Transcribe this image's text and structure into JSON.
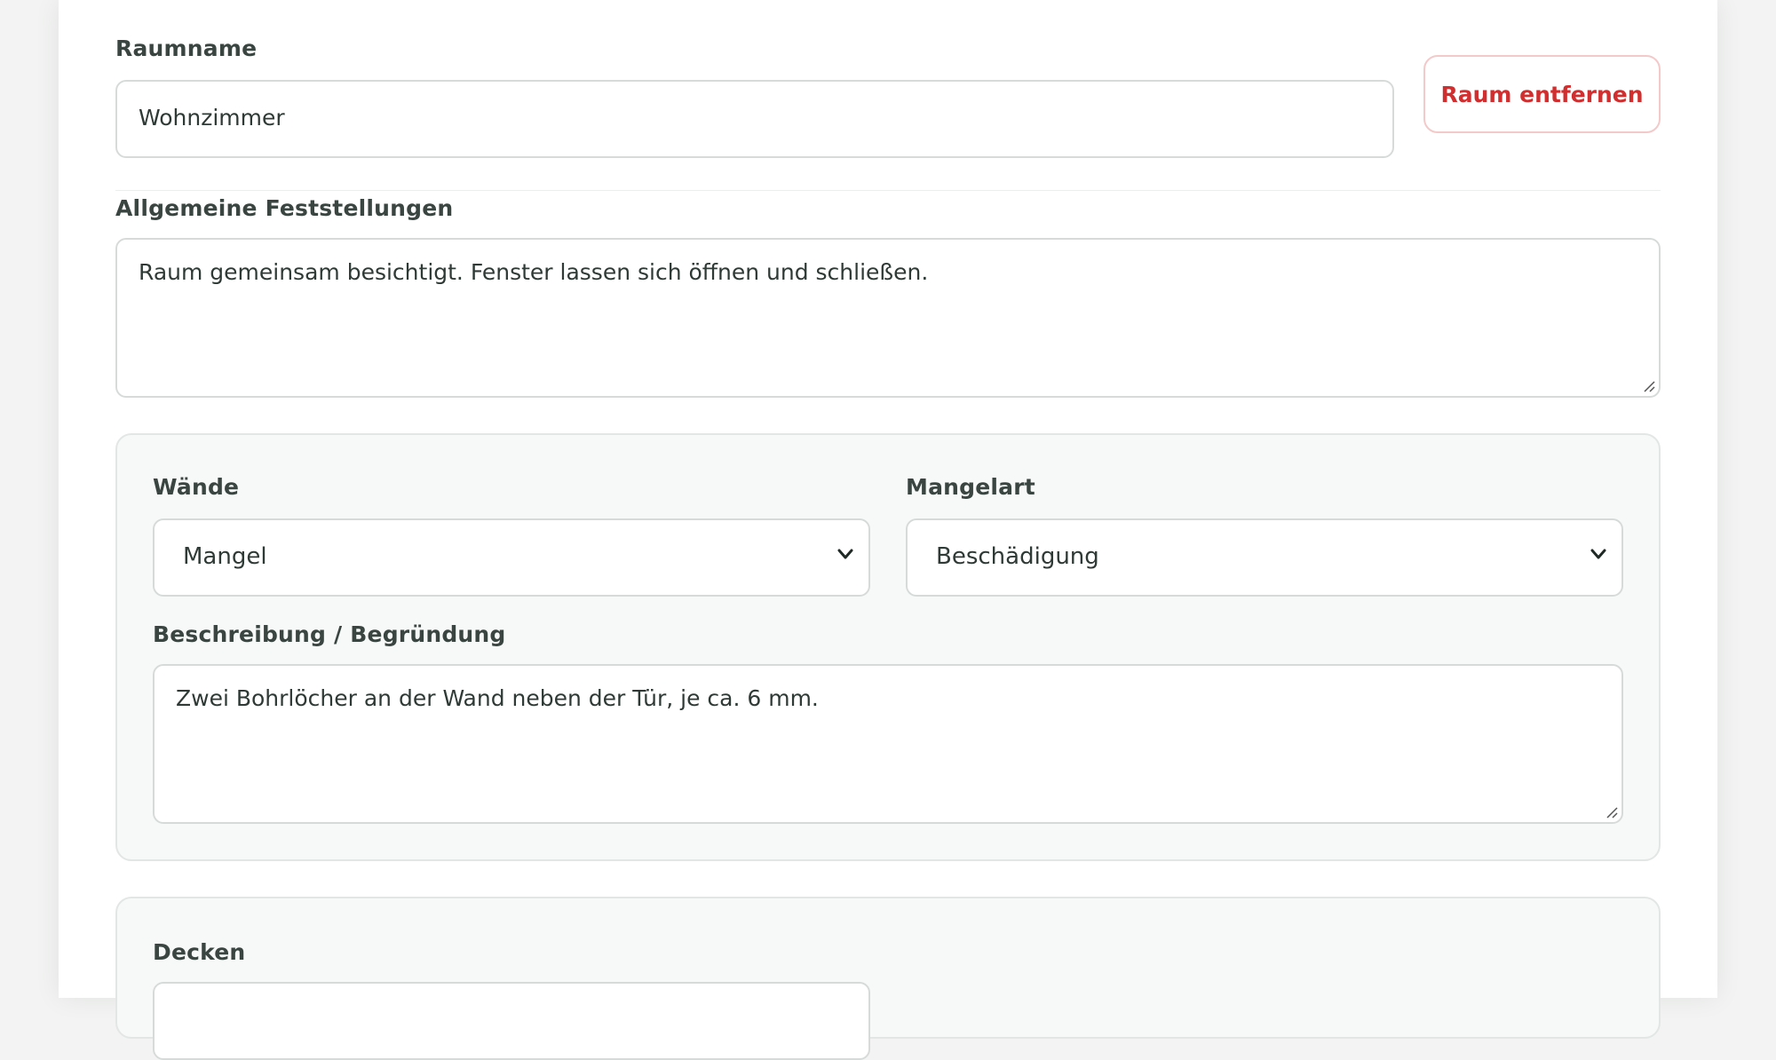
{
  "room": {
    "name_label": "Raumname",
    "name_value": "Wohnzimmer",
    "remove_label": "Raum entfernen"
  },
  "general": {
    "label": "Allgemeine Feststellungen",
    "value": "Raum gemeinsam besichtigt. Fenster lassen sich öffnen und schließen."
  },
  "walls": {
    "label": "Wände",
    "status_value": "Mangel",
    "defect_type_label": "Mangelart",
    "defect_type_value": "Beschädigung",
    "description_label": "Beschreibung / Begründung",
    "description_value": "Zwei Bohrlöcher an der Wand neben der Tür, je ca. 6 mm."
  },
  "ceilings": {
    "label": "Decken"
  },
  "colors": {
    "danger": "#d12f2f",
    "panel_background": "#f7f9f8",
    "border": "#d6dbd9"
  }
}
